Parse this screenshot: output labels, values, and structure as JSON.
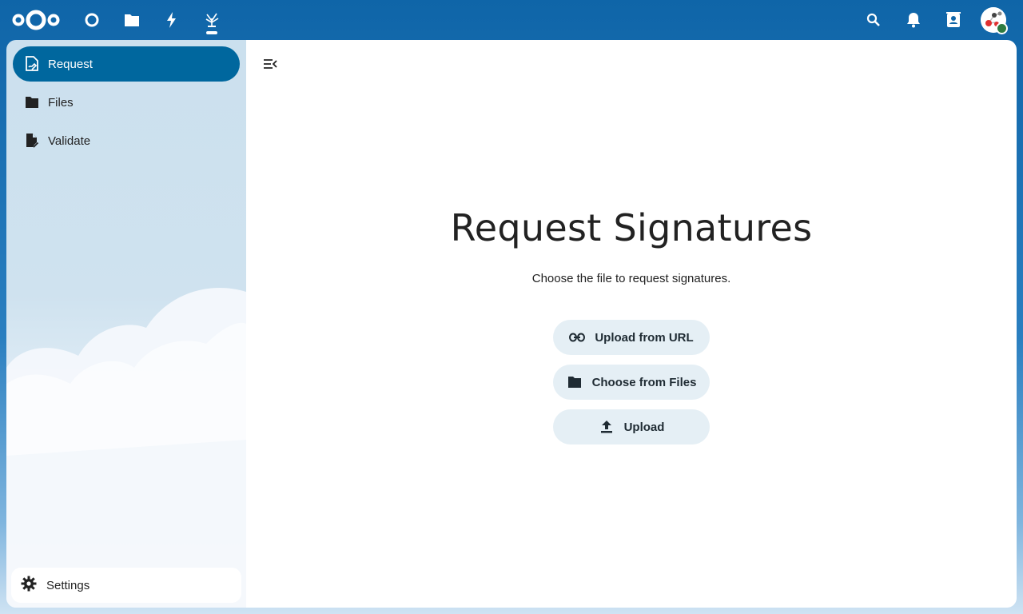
{
  "header": {
    "apps": [
      {
        "name": "dashboard",
        "icon": "circle-icon"
      },
      {
        "name": "files",
        "icon": "folder-icon"
      },
      {
        "name": "activity",
        "icon": "lightning-icon"
      },
      {
        "name": "libresign",
        "icon": "libresign-icon"
      }
    ],
    "actions": [
      "search-icon",
      "bell-icon",
      "contacts-icon"
    ]
  },
  "sidebar": {
    "items": [
      {
        "label": "Request",
        "icon": "signature-icon",
        "active": true
      },
      {
        "label": "Files",
        "icon": "folder-icon",
        "active": false
      },
      {
        "label": "Validate",
        "icon": "file-check-icon",
        "active": false
      }
    ],
    "settings_label": "Settings"
  },
  "main": {
    "title": "Request Signatures",
    "subtitle": "Choose the file to request signatures.",
    "buttons": [
      {
        "label": "Upload from URL",
        "icon": "link-icon"
      },
      {
        "label": "Choose from Files",
        "icon": "folder-icon"
      },
      {
        "label": "Upload",
        "icon": "upload-icon"
      }
    ]
  },
  "colors": {
    "header": "#0f65a8",
    "active_nav": "#00679e",
    "button_bg": "#e5eff5",
    "status": "#2d7b41"
  }
}
